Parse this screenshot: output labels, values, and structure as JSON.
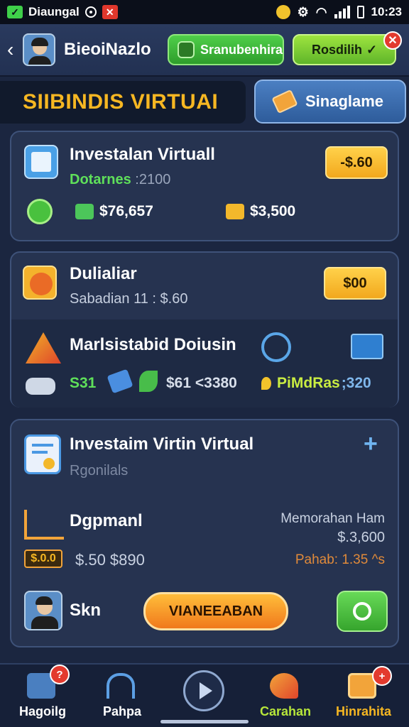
{
  "status_bar": {
    "app_label": "Diaungal",
    "time": "10:23"
  },
  "header": {
    "title": "BieoiNazlo",
    "green_button_label": "Sranubenhira",
    "lime_button_label": "Rosdilih"
  },
  "section": {
    "title": "SIIBINDIS VIRTUAI",
    "button_label": "Sinaglame"
  },
  "card1": {
    "title": "Investalan Virtuall",
    "sub_label": "Dotarnes",
    "sub_value": ":2100",
    "button_label": "-$.60",
    "stat1": "$76,657",
    "stat2": "$3,500"
  },
  "card2": {
    "title": "Dulialiar",
    "sub": "Sabadian 11 : $.60",
    "button_label": "$00",
    "row_title": "Marlsistabid Doiusin",
    "stat1": "S31",
    "stat2": "$61 <3380",
    "stat3_label": "PiMdRas",
    "stat3_value": ";320"
  },
  "card3": {
    "title": "Investaim Virtin Virtual",
    "sub": "Rgonilals",
    "row_title": "Dgpmanl",
    "chip_value": "$.0.0",
    "row_value": "$.50 $890",
    "right_label": "Memorahan Ham",
    "right_value": "$.3,600",
    "right_note": "Pahab: 1.35 ^s",
    "avatar_label": "Skn",
    "orange_button_label": "VIANEEABAN"
  },
  "bottom_nav": {
    "items": [
      {
        "label": "Hagoilg",
        "color": "#ffffff",
        "badge": "?"
      },
      {
        "label": "Pahpa",
        "color": "#ffffff"
      },
      {
        "label": "Carahan",
        "color": "#b7e63a"
      },
      {
        "label": "Hinrahita",
        "color": "#f6b722",
        "badge": "+"
      }
    ]
  },
  "colors": {
    "accent_gold": "#f6b722",
    "accent_green": "#3fcf4a",
    "panel": "#263350",
    "background": "#1b2640"
  }
}
